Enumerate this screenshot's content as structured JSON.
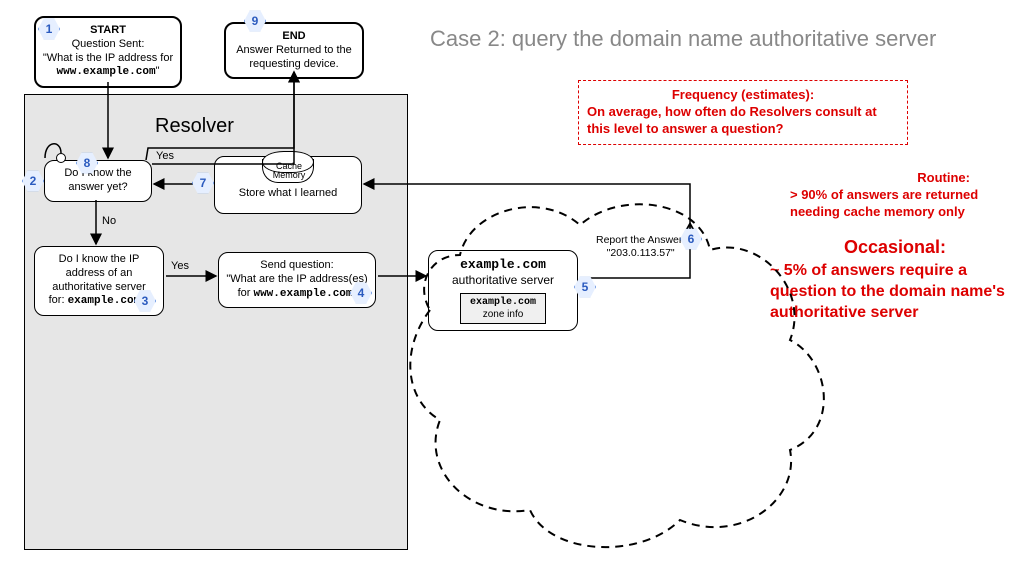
{
  "title": "Case 2: query the domain name authoritative server",
  "resolver_label": "Resolver",
  "start": {
    "heading": "START",
    "line1": "Question Sent:",
    "line2": "\"What is the IP address for",
    "domain": "www.example.com",
    "quote_close": "\""
  },
  "end": {
    "heading": "END",
    "line1": "Answer Returned to the",
    "line2": "requesting device."
  },
  "know_answer": {
    "line1": "Do I know the",
    "line2": "answer yet?"
  },
  "know_auth": {
    "line1": "Do I know the IP",
    "line2": "address of an",
    "line3": "authoritative server",
    "for_prefix": "for:",
    "domain": "example.com",
    "q": "?"
  },
  "send_q": {
    "line1": "Send question:",
    "line2": "\"What are the IP address(es)",
    "for_prefix": "for",
    "domain": "www.example.com",
    "quote_close": "\""
  },
  "auth_server": {
    "domain": "example.com",
    "label": "authoritative server",
    "zone_domain": "example.com",
    "zone_label": "zone info"
  },
  "cache": {
    "label": "Cache",
    "label2": "Memory",
    "store": "Store what I learned"
  },
  "report": {
    "line1": "Report the Answer:",
    "ip": "\"203.0.113.57\""
  },
  "edges": {
    "yes1": "Yes",
    "no": "No",
    "yes2": "Yes"
  },
  "steps": {
    "1": "1",
    "2": "2",
    "3": "3",
    "4": "4",
    "5": "5",
    "6": "6",
    "7": "7",
    "8": "8",
    "9": "9"
  },
  "frequency": {
    "title": "Frequency (estimates):",
    "body": "On average, how often do Resolvers consult at this level to answer a question?"
  },
  "routine": {
    "title": "Routine:",
    "body": "> 90% of answers are returned needing cache memory only"
  },
  "occasional": {
    "title": "Occasional:",
    "body": "~ 5% of answers require a question to the domain name's authoritative server"
  }
}
